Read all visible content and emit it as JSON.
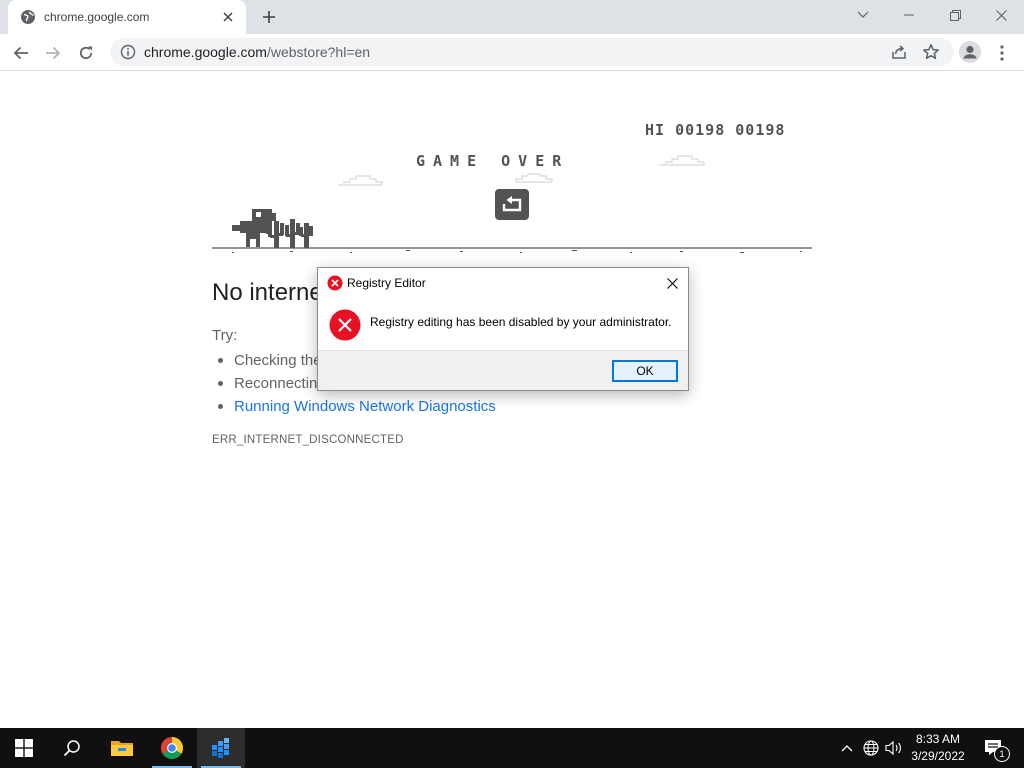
{
  "browser": {
    "tab": {
      "title": "chrome.google.com",
      "favicon": "globe-icon"
    },
    "url": {
      "host": "chrome.google.com",
      "path": "/webstore?hl=en"
    }
  },
  "game": {
    "high_score": "HI 00198 00198",
    "game_over": "GAME OVER"
  },
  "error_page": {
    "title": "No internet",
    "try_label": "Try:",
    "suggestions": [
      "Checking the network cables, modem, and router",
      "Reconnecting to Wi-Fi",
      "Running Windows Network Diagnostics"
    ],
    "error_code": "ERR_INTERNET_DISCONNECTED",
    "link_color": "#1a73e8"
  },
  "dialog": {
    "title": "Registry Editor",
    "message": "Registry editing has been disabled by your administrator.",
    "ok_label": "OK",
    "icon": "error-icon",
    "error_color": "#e81123"
  },
  "taskbar": {
    "time": "8:33 AM",
    "date": "3/29/2022",
    "notification_count": "1",
    "apps": [
      "start-icon",
      "search-icon",
      "file-explorer-icon",
      "chrome-icon",
      "registry-editor-icon"
    ]
  }
}
